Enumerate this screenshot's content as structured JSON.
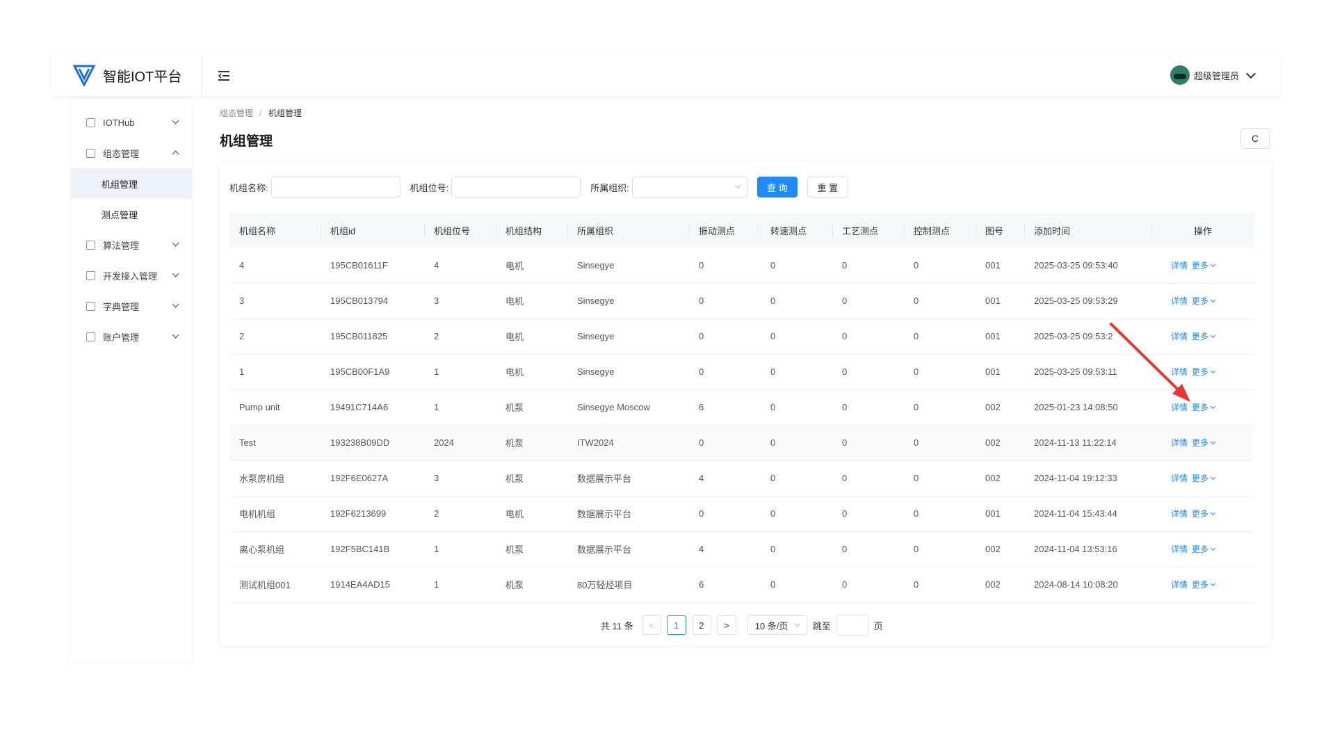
{
  "app": {
    "title": "智能IOT平台",
    "user_name": "超级管理员"
  },
  "sidebar": {
    "items": [
      {
        "label": "IOTHub"
      },
      {
        "label": "组态管理"
      },
      {
        "label": "算法管理"
      },
      {
        "label": "开发接入管理"
      },
      {
        "label": "字典管理"
      },
      {
        "label": "账户管理"
      }
    ],
    "sub_items": [
      {
        "label": "机组管理"
      },
      {
        "label": "测点管理"
      }
    ]
  },
  "breadcrumb": {
    "parent": "组态管理",
    "separator": "/",
    "current": "机组管理"
  },
  "page": {
    "title": "机组管理",
    "refresh_icon": "C"
  },
  "filters": {
    "name_label": "机组名称:",
    "tag_label": "机组位号:",
    "org_label": "所属组织:",
    "search_label": "查 询",
    "reset_label": "重 置"
  },
  "table": {
    "columns": [
      "机组名称",
      "机组id",
      "机组位号",
      "机组结构",
      "所属组织",
      "振动测点",
      "转速测点",
      "工艺测点",
      "控制测点",
      "图号",
      "添加时间",
      "操作"
    ],
    "rows": [
      [
        "4",
        "195CB01611F",
        "4",
        "电机",
        "Sinsegye",
        "0",
        "0",
        "0",
        "0",
        "001",
        "2025-03-25 09:53:40"
      ],
      [
        "3",
        "195CB013794",
        "3",
        "电机",
        "Sinsegye",
        "0",
        "0",
        "0",
        "0",
        "001",
        "2025-03-25 09:53:29"
      ],
      [
        "2",
        "195CB011825",
        "2",
        "电机",
        "Sinsegye",
        "0",
        "0",
        "0",
        "0",
        "001",
        "2025-03-25 09:53:2"
      ],
      [
        "1",
        "195CB00F1A9",
        "1",
        "电机",
        "Sinsegye",
        "0",
        "0",
        "0",
        "0",
        "001",
        "2025-03-25 09:53:11"
      ],
      [
        "Pump unit",
        "19491C714A6",
        "1",
        "机泵",
        "Sinsegye Moscow",
        "6",
        "0",
        "0",
        "0",
        "002",
        "2025-01-23 14:08:50"
      ],
      [
        "Test",
        "193238B09DD",
        "2024",
        "机泵",
        "ITW2024",
        "0",
        "0",
        "0",
        "0",
        "002",
        "2024-11-13 11:22:14"
      ],
      [
        "水泵房机组",
        "192F6E0627A",
        "3",
        "机泵",
        "数据展示平台",
        "4",
        "0",
        "0",
        "0",
        "002",
        "2024-11-04 19:12:33"
      ],
      [
        "电机机组",
        "192F6213699",
        "2",
        "电机",
        "数据展示平台",
        "0",
        "0",
        "0",
        "0",
        "001",
        "2024-11-04 15:43:44"
      ],
      [
        "离心泵机组",
        "192F5BC141B",
        "1",
        "机泵",
        "数据展示平台",
        "4",
        "0",
        "0",
        "0",
        "002",
        "2024-11-04 13:53:16"
      ],
      [
        "测试机组001",
        "1914EA4AD15",
        "1",
        "机泵",
        "80万轻烃项目",
        "6",
        "0",
        "0",
        "0",
        "002",
        "2024-08-14 10:08:20"
      ]
    ],
    "detail_label": "详情",
    "more_label": "更多"
  },
  "pagination": {
    "total_text": "共 11 条",
    "prev": "<",
    "pages": [
      "1",
      "2"
    ],
    "current": "1",
    "next": ">",
    "page_size": "10 条/页",
    "jump_label": "跳至",
    "page_suffix": "页"
  },
  "colors": {
    "primary": "#1d8cf8",
    "annotation_arrow": "#e8372f"
  }
}
